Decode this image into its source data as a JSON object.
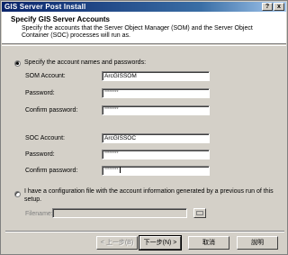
{
  "window": {
    "title": "GIS Server Post Install",
    "help_glyph": "?",
    "close_glyph": "x"
  },
  "header": {
    "title": "Specify GIS Server Accounts",
    "description": "Specify the accounts that the Server Object Manager (SOM) and the Server Object Container (SOC) processes will run as."
  },
  "option_accounts": {
    "label": "Specify the account names and passwords:",
    "selected": true,
    "som": {
      "account_label": "SOM Account:",
      "account_value": "ArcGISSOM",
      "password_label": "Password:",
      "password_value": "********",
      "confirm_label": "Confirm password:",
      "confirm_value": "********"
    },
    "soc": {
      "account_label": "SOC Account:",
      "account_value": "ArcGISSOC",
      "password_label": "Password:",
      "password_value": "********",
      "confirm_label": "Confirm password:",
      "confirm_value": "********"
    }
  },
  "option_config": {
    "label": "I have a configuration file with the account information generated by a previous run of this setup.",
    "selected": false,
    "filename_label": "Filename:",
    "filename_value": ""
  },
  "buttons": {
    "back": "< 上一步(B)",
    "next": "下一步(N) >",
    "cancel": "取消",
    "help": "說明"
  }
}
